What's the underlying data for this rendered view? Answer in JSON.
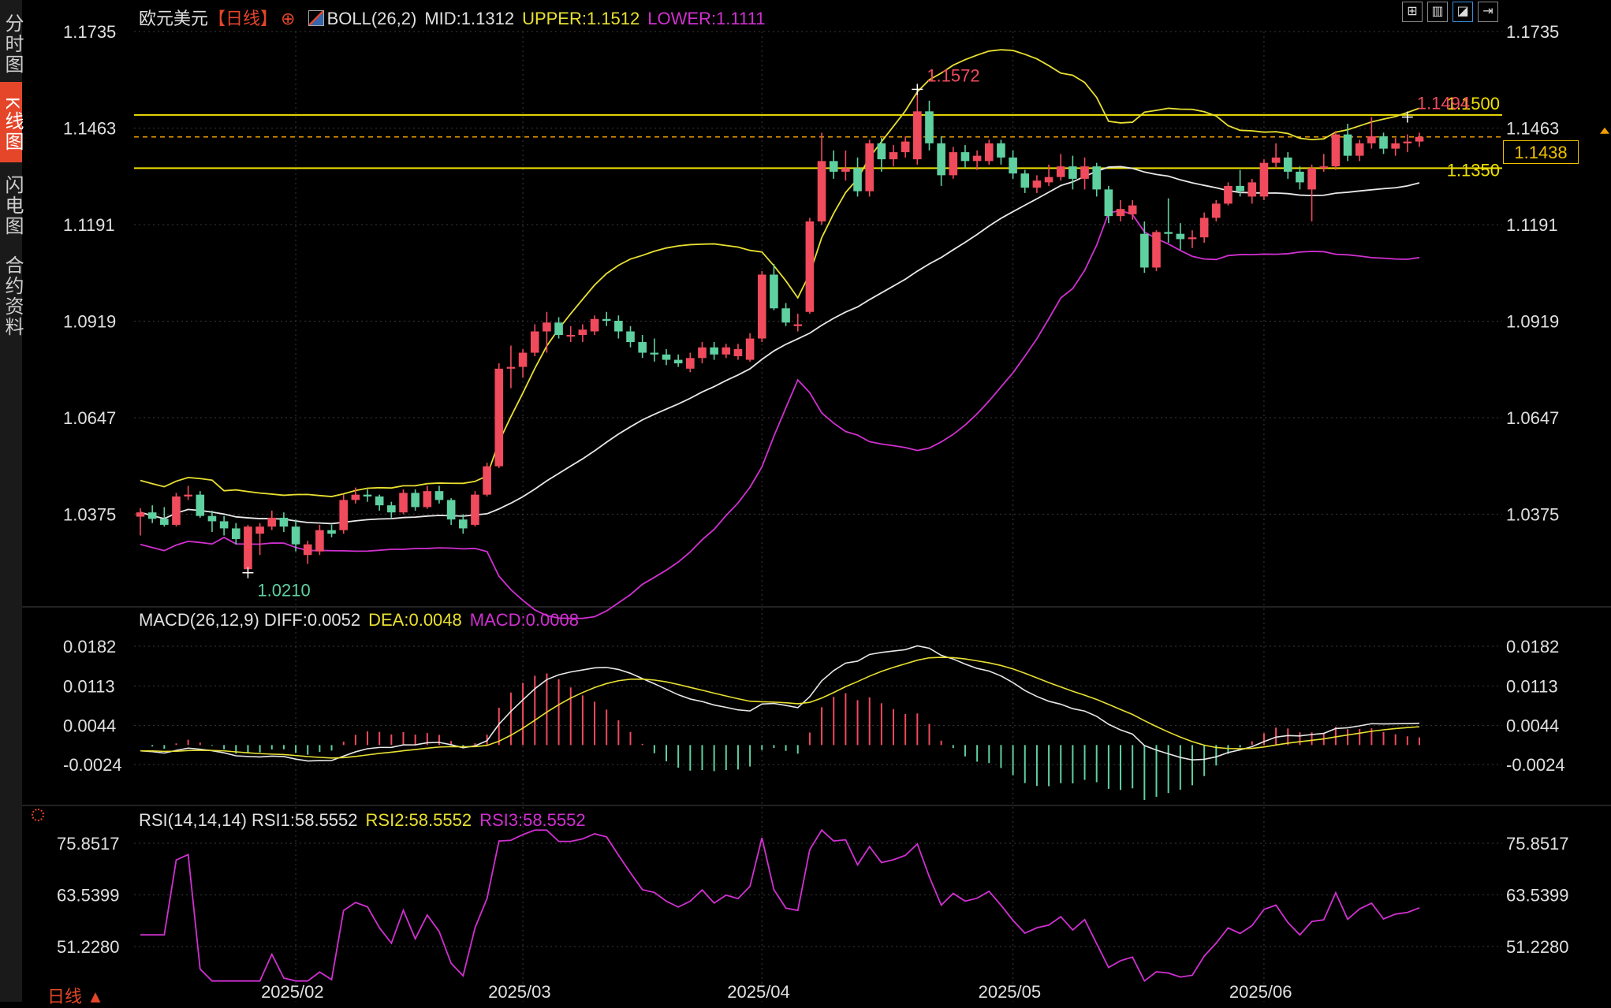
{
  "sidebar": {
    "tabs": [
      {
        "label": "分时图",
        "active": false
      },
      {
        "label": "K线图",
        "active": true
      },
      {
        "label": "闪电图",
        "active": false
      },
      {
        "label": "合约资料",
        "active": false
      }
    ]
  },
  "header": {
    "symbol": "欧元美元",
    "period": "【日线】",
    "boll_label": "BOLL(26,2)",
    "mid": "MID:1.1312",
    "upper": "UPPER:1.1512",
    "lower": "LOWER:1.1111"
  },
  "macd_header": {
    "label": "MACD(26,12,9)",
    "diff": "DIFF:0.0052",
    "dea": "DEA:0.0048",
    "macd": "MACD:0.0008"
  },
  "rsi_header": {
    "label": "RSI(14,14,14)",
    "rsi1": "RSI1:58.5552",
    "rsi2": "RSI2:58.5552",
    "rsi3": "RSI3:58.5552"
  },
  "bottom_tab": "日线 ▲",
  "current_price": "1.1438",
  "colors": {
    "up": "#f04b5c",
    "down": "#5fd0a0",
    "mid": "#e8e8e8",
    "upper": "#e8e030",
    "lower": "#d030d0",
    "level": "#f0e000",
    "grid": "#3a3a3a"
  },
  "chart_data": [
    {
      "type": "candlestick",
      "indicator": "BOLL(26,2)",
      "y_ticks": [
        "1.1735",
        "1.1463",
        "1.1191",
        "1.0919",
        "1.0647",
        "1.0375"
      ],
      "ylim": [
        1.0125,
        1.1735
      ],
      "x_ticks": [
        {
          "label": "2025/02",
          "index": 13
        },
        {
          "label": "2025/03",
          "index": 32
        },
        {
          "label": "2025/04",
          "index": 52
        },
        {
          "label": "2025/05",
          "index": 73
        },
        {
          "label": "2025/06",
          "index": 94
        }
      ],
      "candles": [
        {
          "o": 1.0368,
          "h": 1.0392,
          "l": 1.0315,
          "c": 1.038
        },
        {
          "o": 1.038,
          "h": 1.04,
          "l": 1.035,
          "c": 1.0362
        },
        {
          "o": 1.0362,
          "h": 1.0395,
          "l": 1.034,
          "c": 1.0345
        },
        {
          "o": 1.0345,
          "h": 1.0435,
          "l": 1.034,
          "c": 1.0425
        },
        {
          "o": 1.0425,
          "h": 1.0455,
          "l": 1.0415,
          "c": 1.043
        },
        {
          "o": 1.043,
          "h": 1.044,
          "l": 1.0365,
          "c": 1.037
        },
        {
          "o": 1.037,
          "h": 1.0385,
          "l": 1.0325,
          "c": 1.0355
        },
        {
          "o": 1.0355,
          "h": 1.037,
          "l": 1.0315,
          "c": 1.0335
        },
        {
          "o": 1.0335,
          "h": 1.035,
          "l": 1.029,
          "c": 1.0305
        },
        {
          "o": 1.022,
          "h": 1.0345,
          "l": 1.021,
          "c": 1.034
        },
        {
          "o": 1.032,
          "h": 1.035,
          "l": 1.026,
          "c": 1.034
        },
        {
          "o": 1.034,
          "h": 1.0385,
          "l": 1.033,
          "c": 1.0365
        },
        {
          "o": 1.0365,
          "h": 1.038,
          "l": 1.0325,
          "c": 1.034
        },
        {
          "o": 1.034,
          "h": 1.036,
          "l": 1.027,
          "c": 1.029
        },
        {
          "o": 1.026,
          "h": 1.03,
          "l": 1.0235,
          "c": 1.029
        },
        {
          "o": 1.027,
          "h": 1.0345,
          "l": 1.026,
          "c": 1.033
        },
        {
          "o": 1.033,
          "h": 1.0345,
          "l": 1.031,
          "c": 1.032
        },
        {
          "o": 1.033,
          "h": 1.043,
          "l": 1.032,
          "c": 1.0415
        },
        {
          "o": 1.0415,
          "h": 1.045,
          "l": 1.0405,
          "c": 1.043
        },
        {
          "o": 1.043,
          "h": 1.0445,
          "l": 1.041,
          "c": 1.0425
        },
        {
          "o": 1.0425,
          "h": 1.043,
          "l": 1.0385,
          "c": 1.04
        },
        {
          "o": 1.04,
          "h": 1.041,
          "l": 1.0365,
          "c": 1.038
        },
        {
          "o": 1.038,
          "h": 1.0445,
          "l": 1.0375,
          "c": 1.0435
        },
        {
          "o": 1.0435,
          "h": 1.0445,
          "l": 1.0385,
          "c": 1.0395
        },
        {
          "o": 1.0395,
          "h": 1.0455,
          "l": 1.039,
          "c": 1.044
        },
        {
          "o": 1.044,
          "h": 1.0455,
          "l": 1.0405,
          "c": 1.0415
        },
        {
          "o": 1.0415,
          "h": 1.042,
          "l": 1.0345,
          "c": 1.036
        },
        {
          "o": 1.036,
          "h": 1.0375,
          "l": 1.032,
          "c": 1.0335
        },
        {
          "o": 1.0345,
          "h": 1.044,
          "l": 1.034,
          "c": 1.043
        },
        {
          "o": 1.043,
          "h": 1.052,
          "l": 1.0425,
          "c": 1.051
        },
        {
          "o": 1.051,
          "h": 1.08,
          "l": 1.0505,
          "c": 1.0785
        },
        {
          "o": 1.0785,
          "h": 1.085,
          "l": 1.073,
          "c": 1.079
        },
        {
          "o": 1.079,
          "h": 1.084,
          "l": 1.076,
          "c": 1.083
        },
        {
          "o": 1.083,
          "h": 1.091,
          "l": 1.082,
          "c": 1.089
        },
        {
          "o": 1.089,
          "h": 1.0945,
          "l": 1.083,
          "c": 1.0915
        },
        {
          "o": 1.0915,
          "h": 1.093,
          "l": 1.087,
          "c": 1.088
        },
        {
          "o": 1.088,
          "h": 1.0905,
          "l": 1.086,
          "c": 1.088
        },
        {
          "o": 1.088,
          "h": 1.091,
          "l": 1.086,
          "c": 1.0895
        },
        {
          "o": 1.089,
          "h": 1.0935,
          "l": 1.088,
          "c": 1.0925
        },
        {
          "o": 1.0925,
          "h": 1.0945,
          "l": 1.0905,
          "c": 1.092
        },
        {
          "o": 1.092,
          "h": 1.0935,
          "l": 1.087,
          "c": 1.089
        },
        {
          "o": 1.089,
          "h": 1.0905,
          "l": 1.0845,
          "c": 1.086
        },
        {
          "o": 1.086,
          "h": 1.088,
          "l": 1.0815,
          "c": 1.083
        },
        {
          "o": 1.083,
          "h": 1.087,
          "l": 1.0805,
          "c": 1.0825
        },
        {
          "o": 1.0825,
          "h": 1.084,
          "l": 1.0795,
          "c": 1.081
        },
        {
          "o": 1.081,
          "h": 1.0825,
          "l": 1.079,
          "c": 1.08
        },
        {
          "o": 1.0785,
          "h": 1.083,
          "l": 1.0775,
          "c": 1.0815
        },
        {
          "o": 1.0815,
          "h": 1.086,
          "l": 1.08,
          "c": 1.0845
        },
        {
          "o": 1.0845,
          "h": 1.086,
          "l": 1.081,
          "c": 1.0825
        },
        {
          "o": 1.0825,
          "h": 1.0855,
          "l": 1.0815,
          "c": 1.0845
        },
        {
          "o": 1.082,
          "h": 1.0855,
          "l": 1.081,
          "c": 1.084
        },
        {
          "o": 1.081,
          "h": 1.0885,
          "l": 1.0805,
          "c": 1.087
        },
        {
          "o": 1.087,
          "h": 1.106,
          "l": 1.086,
          "c": 1.105
        },
        {
          "o": 1.105,
          "h": 1.108,
          "l": 1.095,
          "c": 1.0955
        },
        {
          "o": 1.0955,
          "h": 1.097,
          "l": 1.0905,
          "c": 1.0915
        },
        {
          "o": 1.0905,
          "h": 1.094,
          "l": 1.089,
          "c": 1.091
        },
        {
          "o": 1.0945,
          "h": 1.121,
          "l": 1.094,
          "c": 1.12
        },
        {
          "o": 1.12,
          "h": 1.145,
          "l": 1.119,
          "c": 1.137
        },
        {
          "o": 1.137,
          "h": 1.14,
          "l": 1.132,
          "c": 1.134
        },
        {
          "o": 1.134,
          "h": 1.14,
          "l": 1.1315,
          "c": 1.135
        },
        {
          "o": 1.135,
          "h": 1.138,
          "l": 1.127,
          "c": 1.1285
        },
        {
          "o": 1.1285,
          "h": 1.143,
          "l": 1.127,
          "c": 1.142
        },
        {
          "o": 1.142,
          "h": 1.1435,
          "l": 1.134,
          "c": 1.1375
        },
        {
          "o": 1.1375,
          "h": 1.1415,
          "l": 1.1355,
          "c": 1.1395
        },
        {
          "o": 1.1395,
          "h": 1.144,
          "l": 1.138,
          "c": 1.1425
        },
        {
          "o": 1.1375,
          "h": 1.1572,
          "l": 1.136,
          "c": 1.151
        },
        {
          "o": 1.151,
          "h": 1.154,
          "l": 1.14,
          "c": 1.142
        },
        {
          "o": 1.142,
          "h": 1.144,
          "l": 1.13,
          "c": 1.133
        },
        {
          "o": 1.133,
          "h": 1.141,
          "l": 1.132,
          "c": 1.1395
        },
        {
          "o": 1.1395,
          "h": 1.1415,
          "l": 1.135,
          "c": 1.137
        },
        {
          "o": 1.137,
          "h": 1.14,
          "l": 1.1345,
          "c": 1.1385
        },
        {
          "o": 1.137,
          "h": 1.143,
          "l": 1.136,
          "c": 1.142
        },
        {
          "o": 1.142,
          "h": 1.143,
          "l": 1.136,
          "c": 1.138
        },
        {
          "o": 1.138,
          "h": 1.14,
          "l": 1.132,
          "c": 1.1335
        },
        {
          "o": 1.1335,
          "h": 1.1345,
          "l": 1.128,
          "c": 1.1295
        },
        {
          "o": 1.1295,
          "h": 1.133,
          "l": 1.128,
          "c": 1.1315
        },
        {
          "o": 1.131,
          "h": 1.136,
          "l": 1.13,
          "c": 1.1325
        },
        {
          "o": 1.1325,
          "h": 1.139,
          "l": 1.1315,
          "c": 1.1355
        },
        {
          "o": 1.1355,
          "h": 1.1385,
          "l": 1.129,
          "c": 1.132
        },
        {
          "o": 1.132,
          "h": 1.138,
          "l": 1.129,
          "c": 1.1355
        },
        {
          "o": 1.1355,
          "h": 1.1365,
          "l": 1.127,
          "c": 1.129
        },
        {
          "o": 1.129,
          "h": 1.13,
          "l": 1.1195,
          "c": 1.1215
        },
        {
          "o": 1.1215,
          "h": 1.126,
          "l": 1.12,
          "c": 1.1235
        },
        {
          "o": 1.122,
          "h": 1.126,
          "l": 1.1205,
          "c": 1.1245
        },
        {
          "o": 1.1165,
          "h": 1.12,
          "l": 1.1055,
          "c": 1.107
        },
        {
          "o": 1.107,
          "h": 1.1175,
          "l": 1.106,
          "c": 1.117
        },
        {
          "o": 1.117,
          "h": 1.1265,
          "l": 1.114,
          "c": 1.1165
        },
        {
          "o": 1.1165,
          "h": 1.1195,
          "l": 1.112,
          "c": 1.115
        },
        {
          "o": 1.115,
          "h": 1.1175,
          "l": 1.1125,
          "c": 1.1155
        },
        {
          "o": 1.1155,
          "h": 1.1225,
          "l": 1.114,
          "c": 1.121
        },
        {
          "o": 1.121,
          "h": 1.126,
          "l": 1.12,
          "c": 1.125
        },
        {
          "o": 1.125,
          "h": 1.131,
          "l": 1.1245,
          "c": 1.13
        },
        {
          "o": 1.13,
          "h": 1.1345,
          "l": 1.127,
          "c": 1.1285
        },
        {
          "o": 1.127,
          "h": 1.132,
          "l": 1.125,
          "c": 1.131
        },
        {
          "o": 1.127,
          "h": 1.1375,
          "l": 1.126,
          "c": 1.1365
        },
        {
          "o": 1.1365,
          "h": 1.142,
          "l": 1.135,
          "c": 1.138
        },
        {
          "o": 1.138,
          "h": 1.1395,
          "l": 1.132,
          "c": 1.134
        },
        {
          "o": 1.134,
          "h": 1.1355,
          "l": 1.129,
          "c": 1.131
        },
        {
          "o": 1.129,
          "h": 1.136,
          "l": 1.12,
          "c": 1.135
        },
        {
          "o": 1.135,
          "h": 1.139,
          "l": 1.134,
          "c": 1.1355
        },
        {
          "o": 1.1355,
          "h": 1.1455,
          "l": 1.1345,
          "c": 1.1445
        },
        {
          "o": 1.1445,
          "h": 1.1475,
          "l": 1.137,
          "c": 1.1385
        },
        {
          "o": 1.1385,
          "h": 1.143,
          "l": 1.137,
          "c": 1.142
        },
        {
          "o": 1.142,
          "h": 1.1494,
          "l": 1.1405,
          "c": 1.144
        },
        {
          "o": 1.144,
          "h": 1.145,
          "l": 1.139,
          "c": 1.1405
        },
        {
          "o": 1.1405,
          "h": 1.1435,
          "l": 1.1385,
          "c": 1.142
        },
        {
          "o": 1.142,
          "h": 1.1445,
          "l": 1.1395,
          "c": 1.1425
        },
        {
          "o": 1.1425,
          "h": 1.145,
          "l": 1.141,
          "c": 1.1438
        }
      ],
      "annotations": [
        {
          "text": "1.1572",
          "index": 65,
          "price": 1.1572
        },
        {
          "text": "1.0210",
          "index": 9,
          "price": 1.021
        },
        {
          "text": "1.1494",
          "index": 106,
          "price": 1.1494
        }
      ],
      "levels": [
        {
          "price": 1.15,
          "label": "1.1500"
        },
        {
          "price": 1.135,
          "label": "1.1350"
        }
      ],
      "current_price": 1.1438
    },
    {
      "type": "macd",
      "y_ticks": [
        "0.0182",
        "0.0113",
        "0.0044",
        "-0.0024"
      ],
      "ylim": [
        -0.0065,
        0.0215
      ]
    },
    {
      "type": "line",
      "indicator": "RSI(14,14,14)",
      "y_ticks": [
        "75.8517",
        "63.5399",
        "51.2280"
      ],
      "ylim": [
        42,
        80
      ]
    }
  ]
}
